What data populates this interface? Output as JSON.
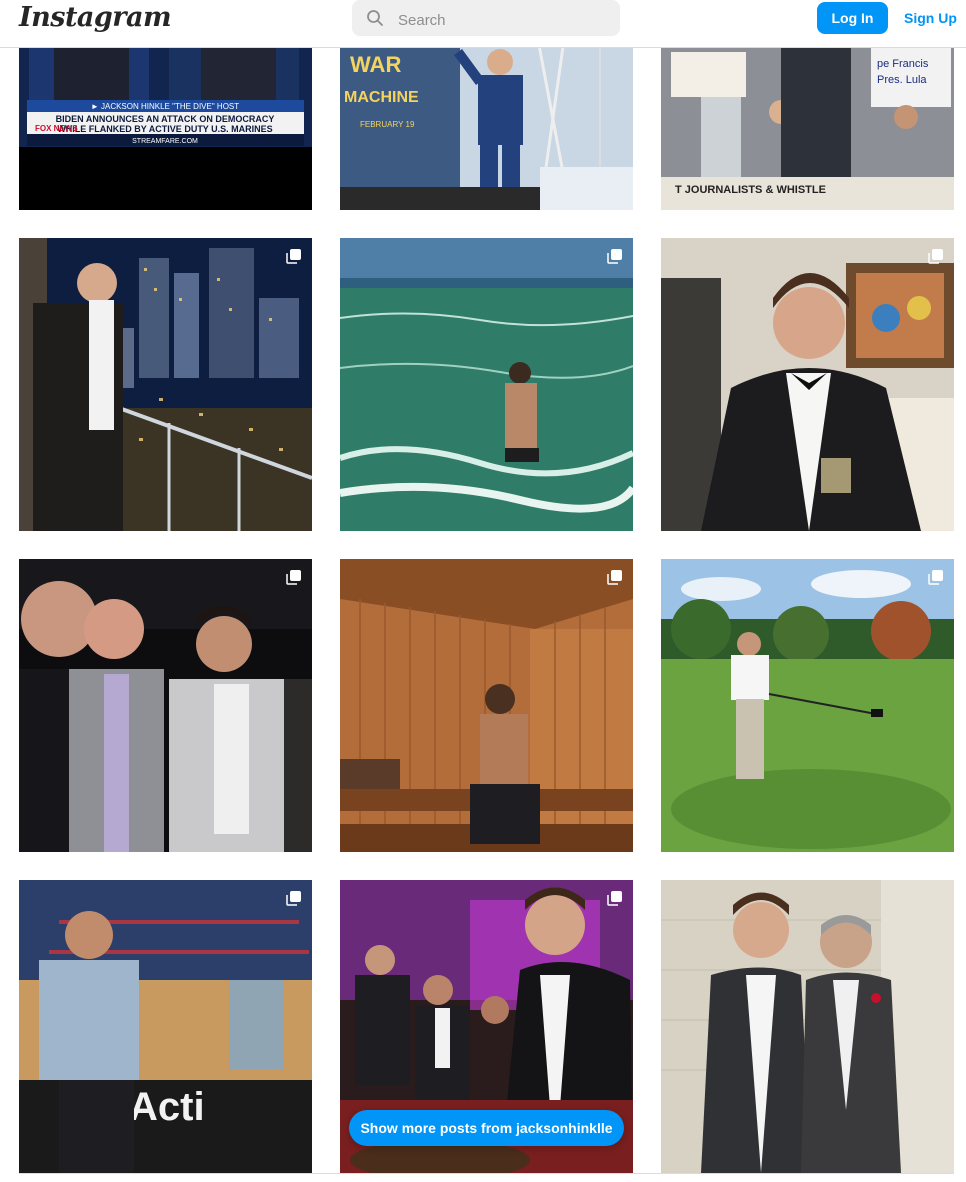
{
  "header": {
    "logo": "Instagram",
    "search_placeholder": "Search",
    "login_label": "Log In",
    "signup_label": "Sign Up"
  },
  "show_more_label": "Show more posts from jacksonhinklle",
  "posts": [
    {
      "name": "post-news-broadcast",
      "caption_line1": "► JACKSON HINKLE  \"THE DIVE\" HOST",
      "caption_line2": "BIDEN ANNOUNCES AN ATTACK ON DEMOCRACY",
      "caption_line3": "WHILE FLANKED BY ACTIVE DUTY U.S. MARINES",
      "caption_line4": "STREAMFARE.COM",
      "network": "FOX NEWS",
      "multiple": false
    },
    {
      "name": "post-war-machine-stage",
      "sign1": "WAR",
      "sign2": "MACHINE",
      "sign3": "FEBRUARY 19",
      "multiple": false
    },
    {
      "name": "post-rally-podium",
      "sign1": "pe Francis",
      "sign2": "Pres. Lula",
      "sign3": "T JOURNALISTS & WHISTLE",
      "multiple": false
    },
    {
      "name": "post-city-balcony",
      "multiple": true
    },
    {
      "name": "post-ocean-swim",
      "multiple": true
    },
    {
      "name": "post-tuxedo-portrait",
      "multiple": true
    },
    {
      "name": "post-group-event",
      "multiple": true
    },
    {
      "name": "post-sauna",
      "multiple": true
    },
    {
      "name": "post-golf",
      "multiple": true
    },
    {
      "name": "post-basketball-court",
      "multiple": true
    },
    {
      "name": "post-casino-party",
      "multiple": true
    },
    {
      "name": "post-two-men-suits",
      "multiple": false
    }
  ],
  "colors": {
    "accent": "#0095f6",
    "border": "#dbdbdb"
  }
}
